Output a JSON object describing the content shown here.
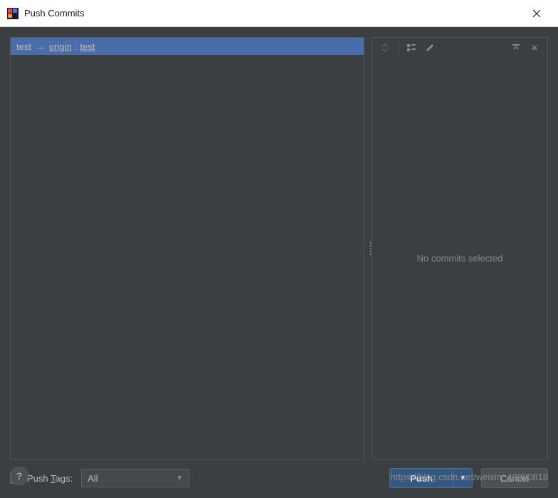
{
  "title": "Push Commits",
  "branch": {
    "local": "test",
    "remote": "origin",
    "remote_branch": "test"
  },
  "right_panel": {
    "empty_text": "No commits selected"
  },
  "push_tags": {
    "label_prefix": "Push ",
    "label_mnemonic": "T",
    "label_suffix": "ags:",
    "selected": "All"
  },
  "buttons": {
    "push": "Push",
    "cancel": "Cancel"
  },
  "watermark": "https://blog.csdn.net/weixin_40990818"
}
